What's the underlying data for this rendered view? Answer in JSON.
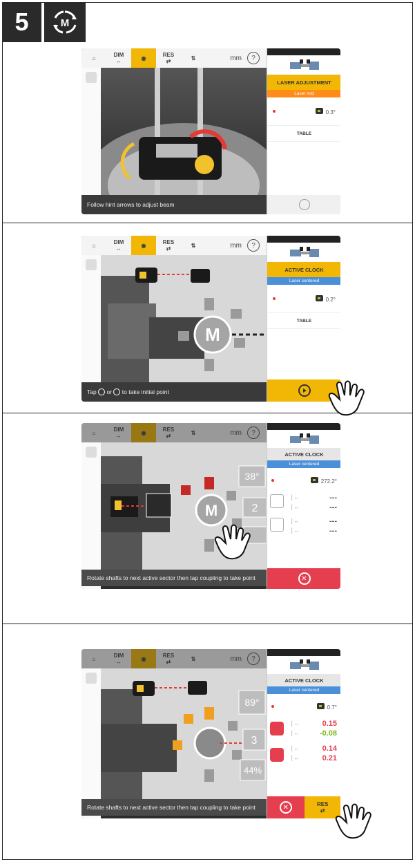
{
  "step": {
    "number": "5"
  },
  "toolbar": {
    "dim": "DIM",
    "res": "RES",
    "units": "mm",
    "help": "?"
  },
  "panel1": {
    "header": "LASER ADJUSTMENT",
    "sub": "Laser mid",
    "reading": "0.3°",
    "table": "TABLE",
    "caption": "Follow hint arrows to adjust beam"
  },
  "panel2": {
    "header": "ACTIVE CLOCK",
    "sub": "Laser centered",
    "reading": "0.2°",
    "table": "TABLE",
    "caption_pre": "Tap",
    "caption_mid": "or",
    "caption_post": "to take initial point",
    "coupling_label": "M"
  },
  "panel3": {
    "header": "ACTIVE CLOCK",
    "sub": "Laser centered",
    "reading": "272.2°",
    "rows": [
      "---",
      "---",
      "---",
      "---"
    ],
    "caption": "Rotate shafts to next active sector then tap coupling to take point",
    "angle": "38°",
    "count": "2",
    "coupling_label": "M"
  },
  "panel4": {
    "header": "ACTIVE CLOCK",
    "sub": "Laser centered",
    "reading": "0.7°",
    "values": [
      "0.15",
      "-0.08",
      "0.14",
      "0.21"
    ],
    "caption": "Rotate shafts to next active sector then tap coupling to take point",
    "angle": "89°",
    "count": "3",
    "percent": "44%",
    "res_button": "RES"
  },
  "colors": {
    "accent": "#f2b705",
    "orange": "#ff8c1a",
    "blue": "#4a90d9",
    "red": "#e53e4f",
    "green": "#7cb518"
  }
}
